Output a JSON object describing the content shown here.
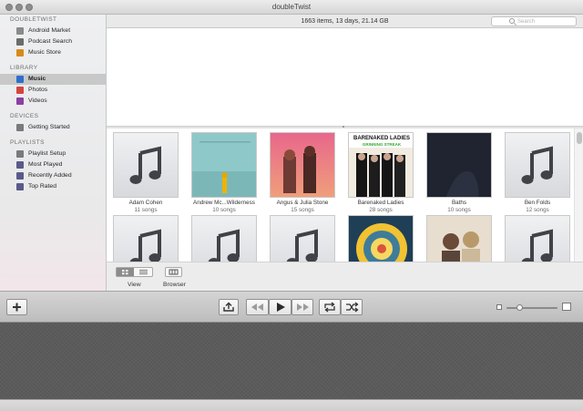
{
  "window": {
    "title": "doubleTwist"
  },
  "info": {
    "summary": "1663 items, 13 days, 21.14 GB"
  },
  "search": {
    "placeholder": "Search"
  },
  "sidebar": {
    "sections": [
      {
        "header": "DOUBLETWIST",
        "items": [
          {
            "label": "Android Market",
            "icon": "android-market-icon"
          },
          {
            "label": "Podcast Search",
            "icon": "podcast-icon"
          },
          {
            "label": "Music Store",
            "icon": "music-store-icon"
          }
        ]
      },
      {
        "header": "LIBRARY",
        "items": [
          {
            "label": "Music",
            "icon": "music-icon",
            "selected": true
          },
          {
            "label": "Photos",
            "icon": "photos-icon"
          },
          {
            "label": "Videos",
            "icon": "videos-icon"
          }
        ]
      },
      {
        "header": "DEVICES",
        "items": [
          {
            "label": "Getting Started",
            "icon": "device-icon"
          }
        ]
      },
      {
        "header": "PLAYLISTS",
        "items": [
          {
            "label": "Playlist Setup",
            "icon": "playlist-icon"
          },
          {
            "label": "Most Played",
            "icon": "smart-playlist-icon"
          },
          {
            "label": "Recently Added",
            "icon": "smart-playlist-icon"
          },
          {
            "label": "Top Rated",
            "icon": "smart-playlist-icon"
          }
        ]
      }
    ]
  },
  "albums": [
    {
      "name": "Adam Cohen",
      "count": "11 songs",
      "art": "placeholder"
    },
    {
      "name": "Andrew Mc...Wilderness",
      "count": "10 songs",
      "art": "teal"
    },
    {
      "name": "Angus & Julia Stone",
      "count": "15 songs",
      "art": "sunset"
    },
    {
      "name": "Barenaked Ladies",
      "count": "28 songs",
      "art": "bnl"
    },
    {
      "name": "Baths",
      "count": "10 songs",
      "art": "dark"
    },
    {
      "name": "Ben Folds",
      "count": "12 songs",
      "art": "placeholder"
    },
    {
      "name": "",
      "count": "",
      "art": "placeholder"
    },
    {
      "name": "",
      "count": "",
      "art": "placeholder"
    },
    {
      "name": "",
      "count": "",
      "art": "placeholder"
    },
    {
      "name": "",
      "count": "",
      "art": "mandala"
    },
    {
      "name": "",
      "count": "",
      "art": "duo"
    },
    {
      "name": "",
      "count": "",
      "art": "placeholder"
    }
  ],
  "viewbar": {
    "view_label": "View",
    "browser_label": "Browser"
  },
  "toolbar": {
    "add": "add-icon",
    "sync": "sync-icon",
    "prev": "rewind-icon",
    "play": "play-icon",
    "next": "fast-forward-icon",
    "repeat": "repeat-icon",
    "shuffle": "shuffle-icon"
  },
  "zoom": {
    "level": 0.25
  }
}
